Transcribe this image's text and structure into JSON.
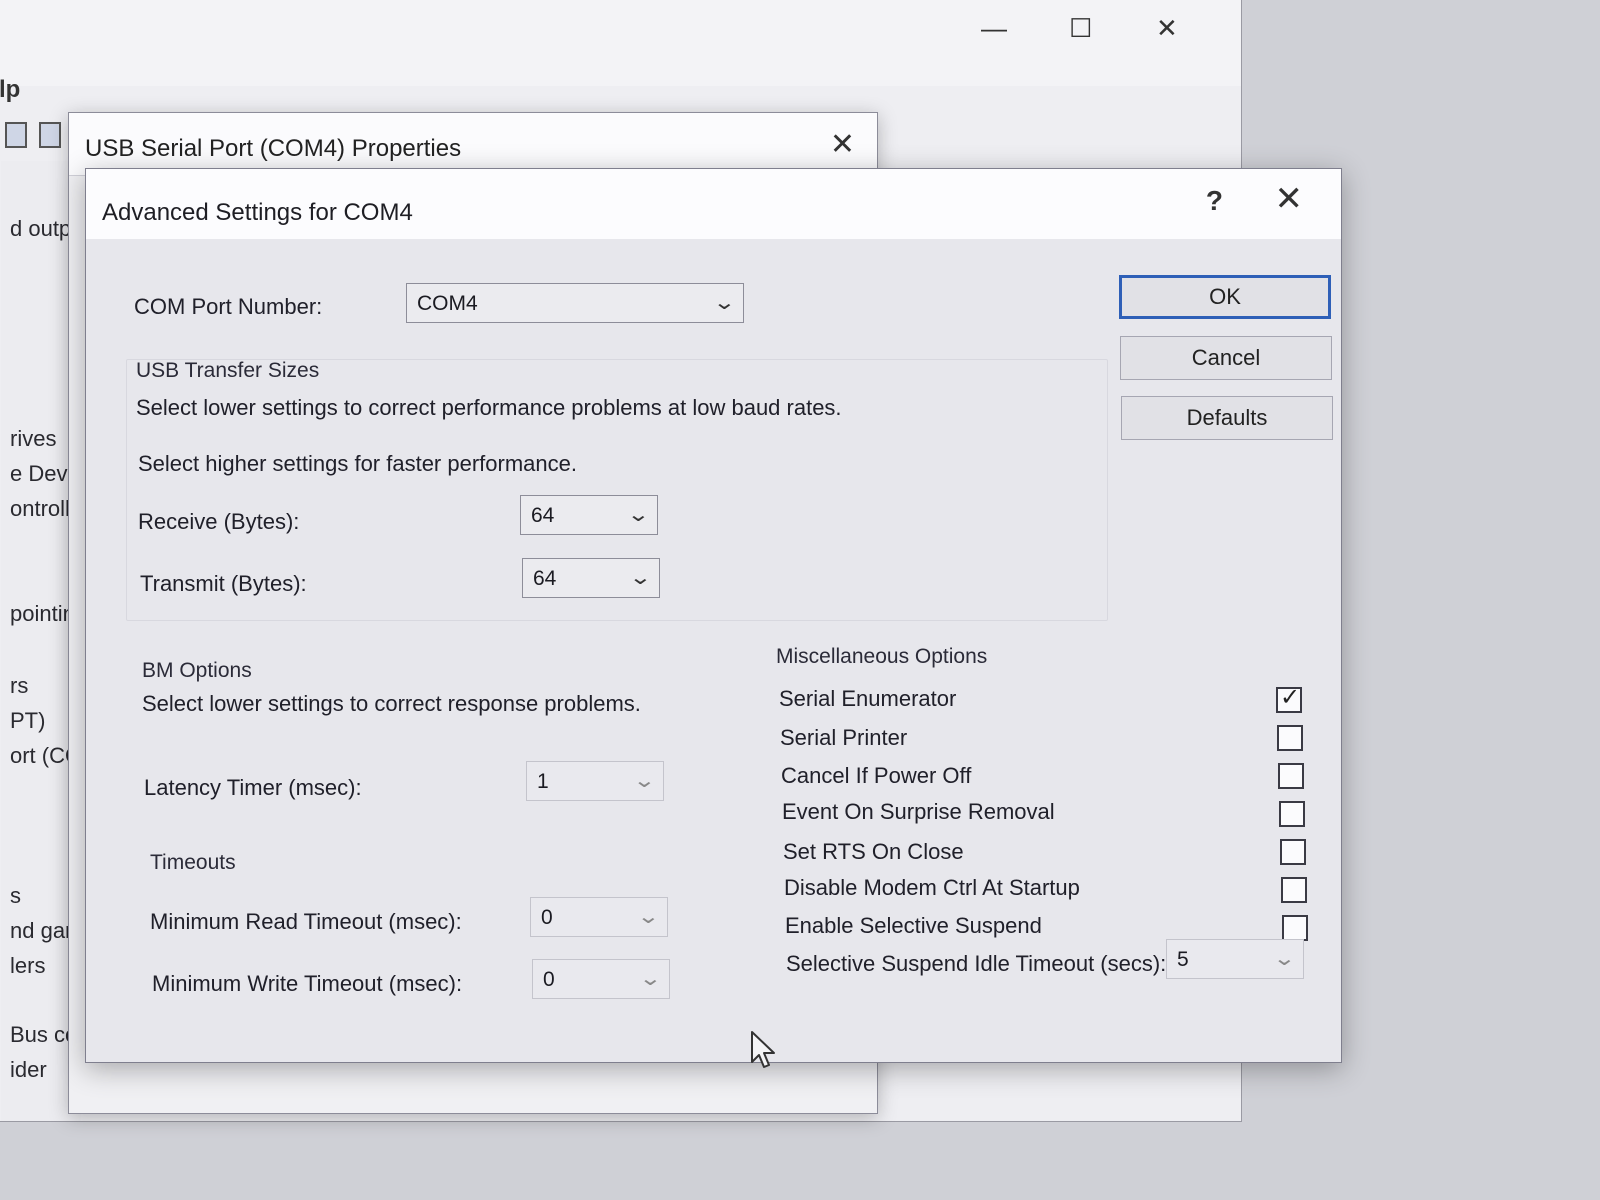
{
  "background_window": {
    "menu_fragment": "lp",
    "controls": {
      "minimize": "—",
      "maximize": "☐",
      "close": "✕"
    },
    "tree_fragments": [
      "d outp",
      "rives",
      "e Devic",
      "ontroll",
      "pointin",
      "rs",
      "PT)",
      "ort (CO",
      "s",
      "nd gam",
      "lers",
      "Bus cont",
      "ider"
    ]
  },
  "properties_window": {
    "title": "USB Serial Port (COM4) Properties",
    "close": "✕"
  },
  "dialog": {
    "title": "Advanced Settings for COM4",
    "help": "?",
    "close": "✕",
    "com_port": {
      "label": "COM Port Number:",
      "value": "COM4"
    },
    "usb_transfer": {
      "title": "USB Transfer Sizes",
      "line1": "Select lower settings to correct performance problems at low baud rates.",
      "line2": "Select higher settings for faster performance.",
      "receive": {
        "label": "Receive (Bytes):",
        "value": "64"
      },
      "transmit": {
        "label": "Transmit (Bytes):",
        "value": "64"
      }
    },
    "bm_options": {
      "title": "BM Options",
      "description": "Select lower settings to correct response problems.",
      "latency": {
        "label": "Latency Timer (msec):",
        "value": "1"
      }
    },
    "timeouts": {
      "title": "Timeouts",
      "min_read": {
        "label": "Minimum Read Timeout (msec):",
        "value": "0"
      },
      "min_write": {
        "label": "Minimum Write Timeout (msec):",
        "value": "0"
      }
    },
    "misc": {
      "title": "Miscellaneous Options",
      "options": [
        {
          "label": "Serial Enumerator",
          "checked": true
        },
        {
          "label": "Serial Printer",
          "checked": false
        },
        {
          "label": "Cancel If Power Off",
          "checked": false
        },
        {
          "label": "Event On Surprise Removal",
          "checked": false
        },
        {
          "label": "Set RTS On Close",
          "checked": false
        },
        {
          "label": "Disable Modem Ctrl At Startup",
          "checked": false
        },
        {
          "label": "Enable Selective Suspend",
          "checked": false
        }
      ],
      "idle_timeout": {
        "label": "Selective Suspend Idle Timeout (secs):",
        "value": "5"
      }
    },
    "buttons": {
      "ok": "OK",
      "cancel": "Cancel",
      "defaults": "Defaults"
    },
    "chevron": "⌄"
  },
  "colors": {
    "default_button_border": "#2e5fb7",
    "dialog_bg": "#e7e7ec"
  }
}
